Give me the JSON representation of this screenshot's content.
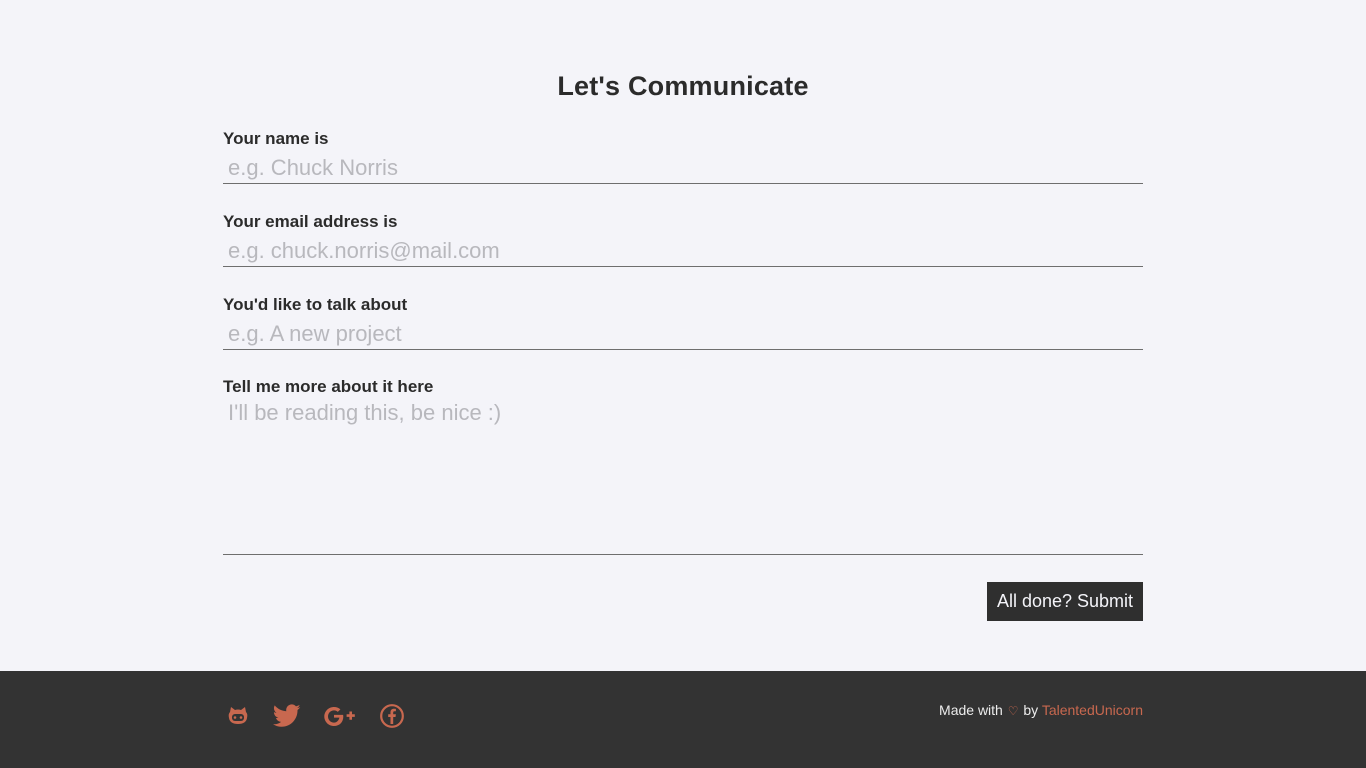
{
  "form": {
    "title": "Let's Communicate",
    "name": {
      "label": "Your name is",
      "placeholder": "e.g. Chuck Norris",
      "value": ""
    },
    "email": {
      "label": "Your email address is",
      "placeholder": "e.g. chuck.norris@mail.com",
      "value": ""
    },
    "topic": {
      "label": "You'd like to talk about",
      "placeholder": "e.g. A new project",
      "value": ""
    },
    "message": {
      "label": "Tell me more about it here",
      "placeholder": "I'll be reading this, be nice :)",
      "value": ""
    },
    "submit_label": "All done? Submit"
  },
  "footer": {
    "social_icons": [
      "github-icon",
      "twitter-icon",
      "google-plus-icon",
      "facebook-icon"
    ],
    "credit_prefix": "Made with",
    "heart": "♡",
    "credit_by": "by",
    "author": "TalentedUnicorn"
  },
  "colors": {
    "background": "#f4f4f9",
    "text": "#2b2b2b",
    "placeholder": "#b8b8bd",
    "footer_bg": "#333333",
    "accent": "#c8684f",
    "button_bg": "#2f2f2f"
  }
}
